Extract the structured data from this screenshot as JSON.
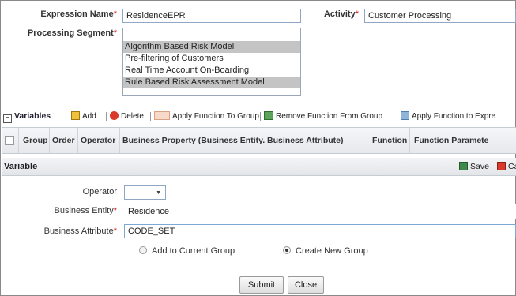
{
  "form": {
    "expression_name_label": "Expression Name",
    "expression_name_value": "ResidenceEPR",
    "activity_label": "Activity",
    "activity_value": "Customer Processing",
    "processing_segment_label": "Processing Segment",
    "required_marker": "*",
    "processing_segment_options": [
      {
        "label": "Algorithm Based Risk Model",
        "selected": true
      },
      {
        "label": "Pre-filtering of Customers",
        "selected": false
      },
      {
        "label": "Real Time Account On-Boarding",
        "selected": false
      },
      {
        "label": "Rule Based Risk Assessment Model",
        "selected": true
      }
    ]
  },
  "toolbar": {
    "variables_label": "Variables",
    "add_label": "Add",
    "delete_label": "Delete",
    "apply_function_group_label": "Apply Function To Group",
    "remove_function_group_label": "Remove Function From Group",
    "apply_function_expression_label": "Apply Function to Expre"
  },
  "grid": {
    "columns": [
      "Group",
      "Order",
      "Operator",
      "Business Property (Business Entity. Business Attribute)",
      "Function",
      "Function Paramete"
    ]
  },
  "variable_panel": {
    "title": "Variable",
    "save_label": "Save",
    "cancel_label": "Ca",
    "operator_label": "Operator",
    "operator_value": "",
    "business_entity_label": "Business Entity",
    "business_entity_value": "Residence",
    "business_attribute_label": "Business Attribute",
    "business_attribute_value": "CODE_SET",
    "add_to_current_group_label": "Add to Current Group",
    "create_new_group_label": "Create New Group",
    "selected_radio": "Create New Group",
    "submit_label": "Submit",
    "close_label": "Close"
  },
  "colors": {
    "selected_option": "#c4c4c4",
    "required_marker": "#cc0000",
    "field_border": "#8fa6c4"
  }
}
